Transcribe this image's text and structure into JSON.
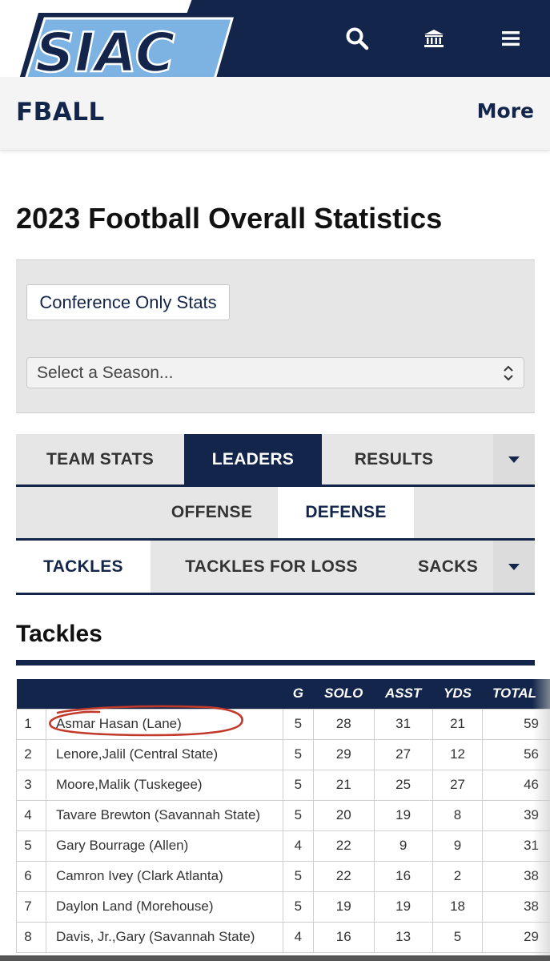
{
  "header": {
    "logo_text": "SIAC",
    "logo_tm": "™",
    "sport": "FBALL",
    "more": "More",
    "icons": [
      "search-icon",
      "institution-icon",
      "hamburger-menu-icon"
    ]
  },
  "page": {
    "title": "2023 Football Overall Statistics"
  },
  "filters": {
    "conference_button": "Conference Only Stats",
    "season_select": "Select a Season..."
  },
  "main_tabs": [
    "TEAM STATS",
    "LEADERS",
    "RESULTS"
  ],
  "side_tabs": [
    "OFFENSE",
    "DEFENSE"
  ],
  "stat_tabs": [
    "TACKLES",
    "TACKLES FOR LOSS",
    "SACKS"
  ],
  "section": {
    "title": "Tackles"
  },
  "table": {
    "columns": [
      "",
      "",
      "G",
      "SOLO",
      "ASST",
      "YDS",
      "TOTAL"
    ],
    "rows": [
      [
        "1",
        "Asmar Hasan (Lane)",
        "5",
        "28",
        "31",
        "21",
        "59"
      ],
      [
        "2",
        "Lenore,Jalil (Central State)",
        "5",
        "29",
        "27",
        "12",
        "56"
      ],
      [
        "3",
        "Moore,Malik (Tuskegee)",
        "5",
        "21",
        "25",
        "27",
        "46"
      ],
      [
        "4",
        "Tavare Brewton (Savannah State)",
        "5",
        "20",
        "19",
        "8",
        "39"
      ],
      [
        "5",
        "Gary Bourrage (Allen)",
        "4",
        "22",
        "9",
        "9",
        "31"
      ],
      [
        "6",
        "Camron Ivey (Clark Atlanta)",
        "5",
        "22",
        "16",
        "2",
        "38"
      ],
      [
        "7",
        "Daylon Land (Morehouse)",
        "5",
        "19",
        "19",
        "18",
        "38"
      ],
      [
        "8",
        "Davis, Jr.,Gary (Savannah State)",
        "4",
        "16",
        "13",
        "5",
        "29"
      ]
    ]
  },
  "colors": {
    "navy": "#13254a",
    "logo_blue": "#7db3e3",
    "annotation": "#c0392b"
  }
}
